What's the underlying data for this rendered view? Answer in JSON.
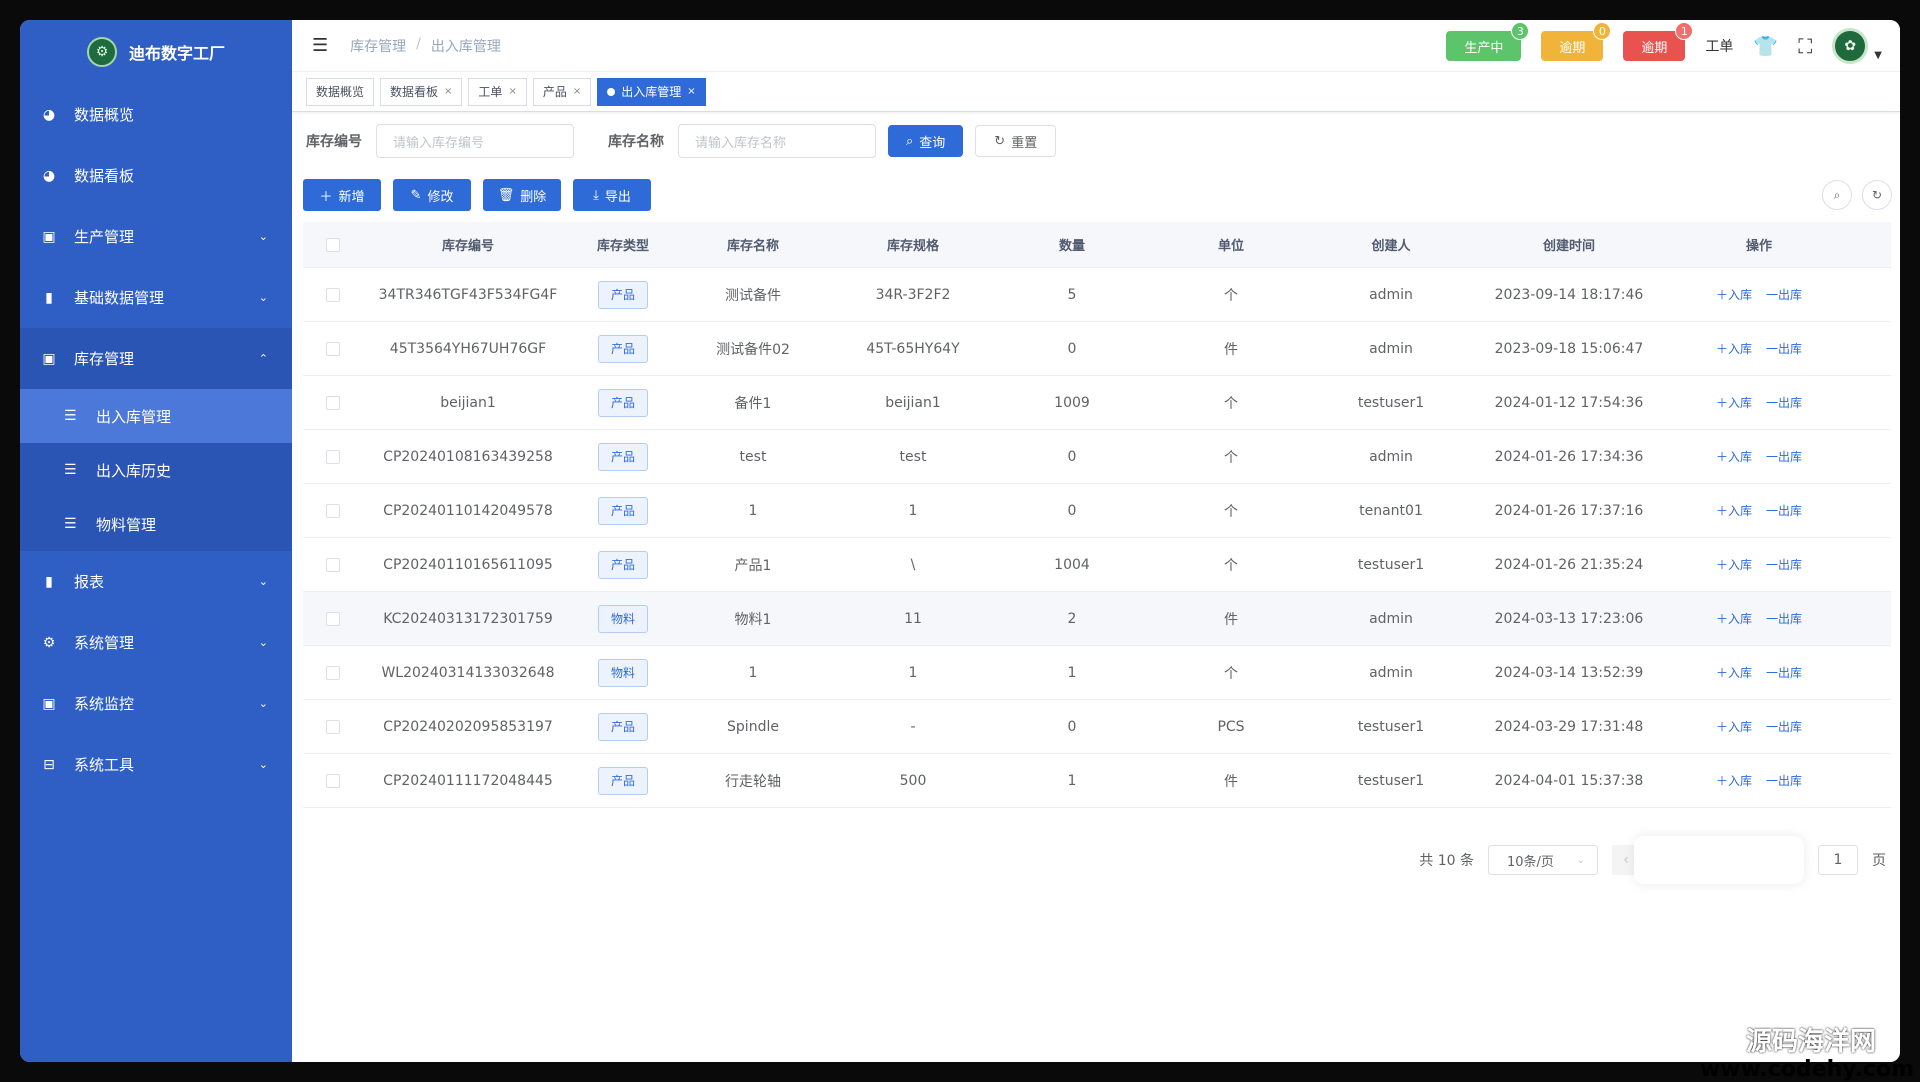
{
  "app": {
    "title": "迪布数字工厂",
    "logo_icon": "factory-logo"
  },
  "sidebar": {
    "items": [
      {
        "label": "数据概览",
        "icon": "dashboard-icon"
      },
      {
        "label": "数据看板",
        "icon": "dashboard-icon"
      },
      {
        "label": "生产管理",
        "icon": "monitor-icon",
        "expandable": true
      },
      {
        "label": "基础数据管理",
        "icon": "book-icon",
        "expandable": true
      },
      {
        "label": "库存管理",
        "icon": "monitor-icon",
        "expandable": true,
        "expanded": true
      },
      {
        "label": "报表",
        "icon": "book-icon",
        "expandable": true
      },
      {
        "label": "系统管理",
        "icon": "gear-icon",
        "expandable": true
      },
      {
        "label": "系统监控",
        "icon": "monitor-icon",
        "expandable": true
      },
      {
        "label": "系统工具",
        "icon": "toolbox-icon",
        "expandable": true
      }
    ],
    "subitems": [
      {
        "label": "出入库管理",
        "active": true
      },
      {
        "label": "出入库历史"
      },
      {
        "label": "物料管理"
      }
    ]
  },
  "navbar": {
    "breadcrumb": [
      "库存管理",
      "出入库管理"
    ],
    "status_buttons": [
      {
        "label": "生产中",
        "count": "3",
        "color": "#5cc46a"
      },
      {
        "label": "逾期",
        "count": "0",
        "color": "#f0b43a"
      },
      {
        "label": "逾期",
        "count": "1",
        "color": "#e9534f"
      }
    ],
    "work_order_label": "工单"
  },
  "tags": [
    {
      "label": "数据概览",
      "closable": false
    },
    {
      "label": "数据看板",
      "closable": true
    },
    {
      "label": "工单",
      "closable": true
    },
    {
      "label": "产品",
      "closable": true
    },
    {
      "label": "出入库管理",
      "closable": true,
      "active": true
    }
  ],
  "search": {
    "code_label": "库存编号",
    "code_placeholder": "请输入库存编号",
    "name_label": "库存名称",
    "name_placeholder": "请输入库存名称",
    "query_label": "查询",
    "reset_label": "重置"
  },
  "actions": {
    "add": "新增",
    "edit": "修改",
    "delete": "删除",
    "export": "导出"
  },
  "table": {
    "headers": [
      "库存编号",
      "库存类型",
      "库存名称",
      "库存规格",
      "数量",
      "单位",
      "创建人",
      "创建时间",
      "操作"
    ],
    "op_in": "入库",
    "op_out": "出库",
    "rows": [
      {
        "code": "34TR346TGF43F534FG4F",
        "type": "产品",
        "name": "测试备件",
        "spec": "34R-3F2F2",
        "qty": "5",
        "unit": "个",
        "creator": "admin",
        "time": "2023-09-14 18:17:46"
      },
      {
        "code": "45T3564YH67UH76GF",
        "type": "产品",
        "name": "测试备件02",
        "spec": "45T-65HY64Y",
        "qty": "0",
        "unit": "件",
        "creator": "admin",
        "time": "2023-09-18 15:06:47"
      },
      {
        "code": "beijian1",
        "type": "产品",
        "name": "备件1",
        "spec": "beijian1",
        "qty": "1009",
        "unit": "个",
        "creator": "testuser1",
        "time": "2024-01-12 17:54:36"
      },
      {
        "code": "CP20240108163439258",
        "type": "产品",
        "name": "test",
        "spec": "test",
        "qty": "0",
        "unit": "个",
        "creator": "admin",
        "time": "2024-01-26 17:34:36"
      },
      {
        "code": "CP20240110142049578",
        "type": "产品",
        "name": "1",
        "spec": "1",
        "qty": "0",
        "unit": "个",
        "creator": "tenant01",
        "time": "2024-01-26 17:37:16"
      },
      {
        "code": "CP20240110165611095",
        "type": "产品",
        "name": "产品1",
        "spec": "\\",
        "qty": "1004",
        "unit": "个",
        "creator": "testuser1",
        "time": "2024-01-26 21:35:24"
      },
      {
        "code": "KC20240313172301759",
        "type": "物料",
        "name": "物料1",
        "spec": "11",
        "qty": "2",
        "unit": "件",
        "creator": "admin",
        "time": "2024-03-13 17:23:06",
        "highlight": true
      },
      {
        "code": "WL20240314133032648",
        "type": "物料",
        "name": "1",
        "spec": "1",
        "qty": "1",
        "unit": "个",
        "creator": "admin",
        "time": "2024-03-14 13:52:39"
      },
      {
        "code": "CP20240202095853197",
        "type": "产品",
        "name": "Spindle",
        "spec": "-",
        "qty": "0",
        "unit": "PCS",
        "creator": "testuser1",
        "time": "2024-03-29 17:31:48"
      },
      {
        "code": "CP20240111172048445",
        "type": "产品",
        "name": "行走轮轴",
        "spec": "500",
        "qty": "1",
        "unit": "件",
        "creator": "testuser1",
        "time": "2024-04-01 15:37:38"
      }
    ]
  },
  "pagination": {
    "total": "共 10 条",
    "page_size": "10条/页",
    "page_input": "1",
    "page_suffix": "页"
  },
  "watermark": {
    "line1": "源码海洋网",
    "line2": "www.codehy.com"
  }
}
